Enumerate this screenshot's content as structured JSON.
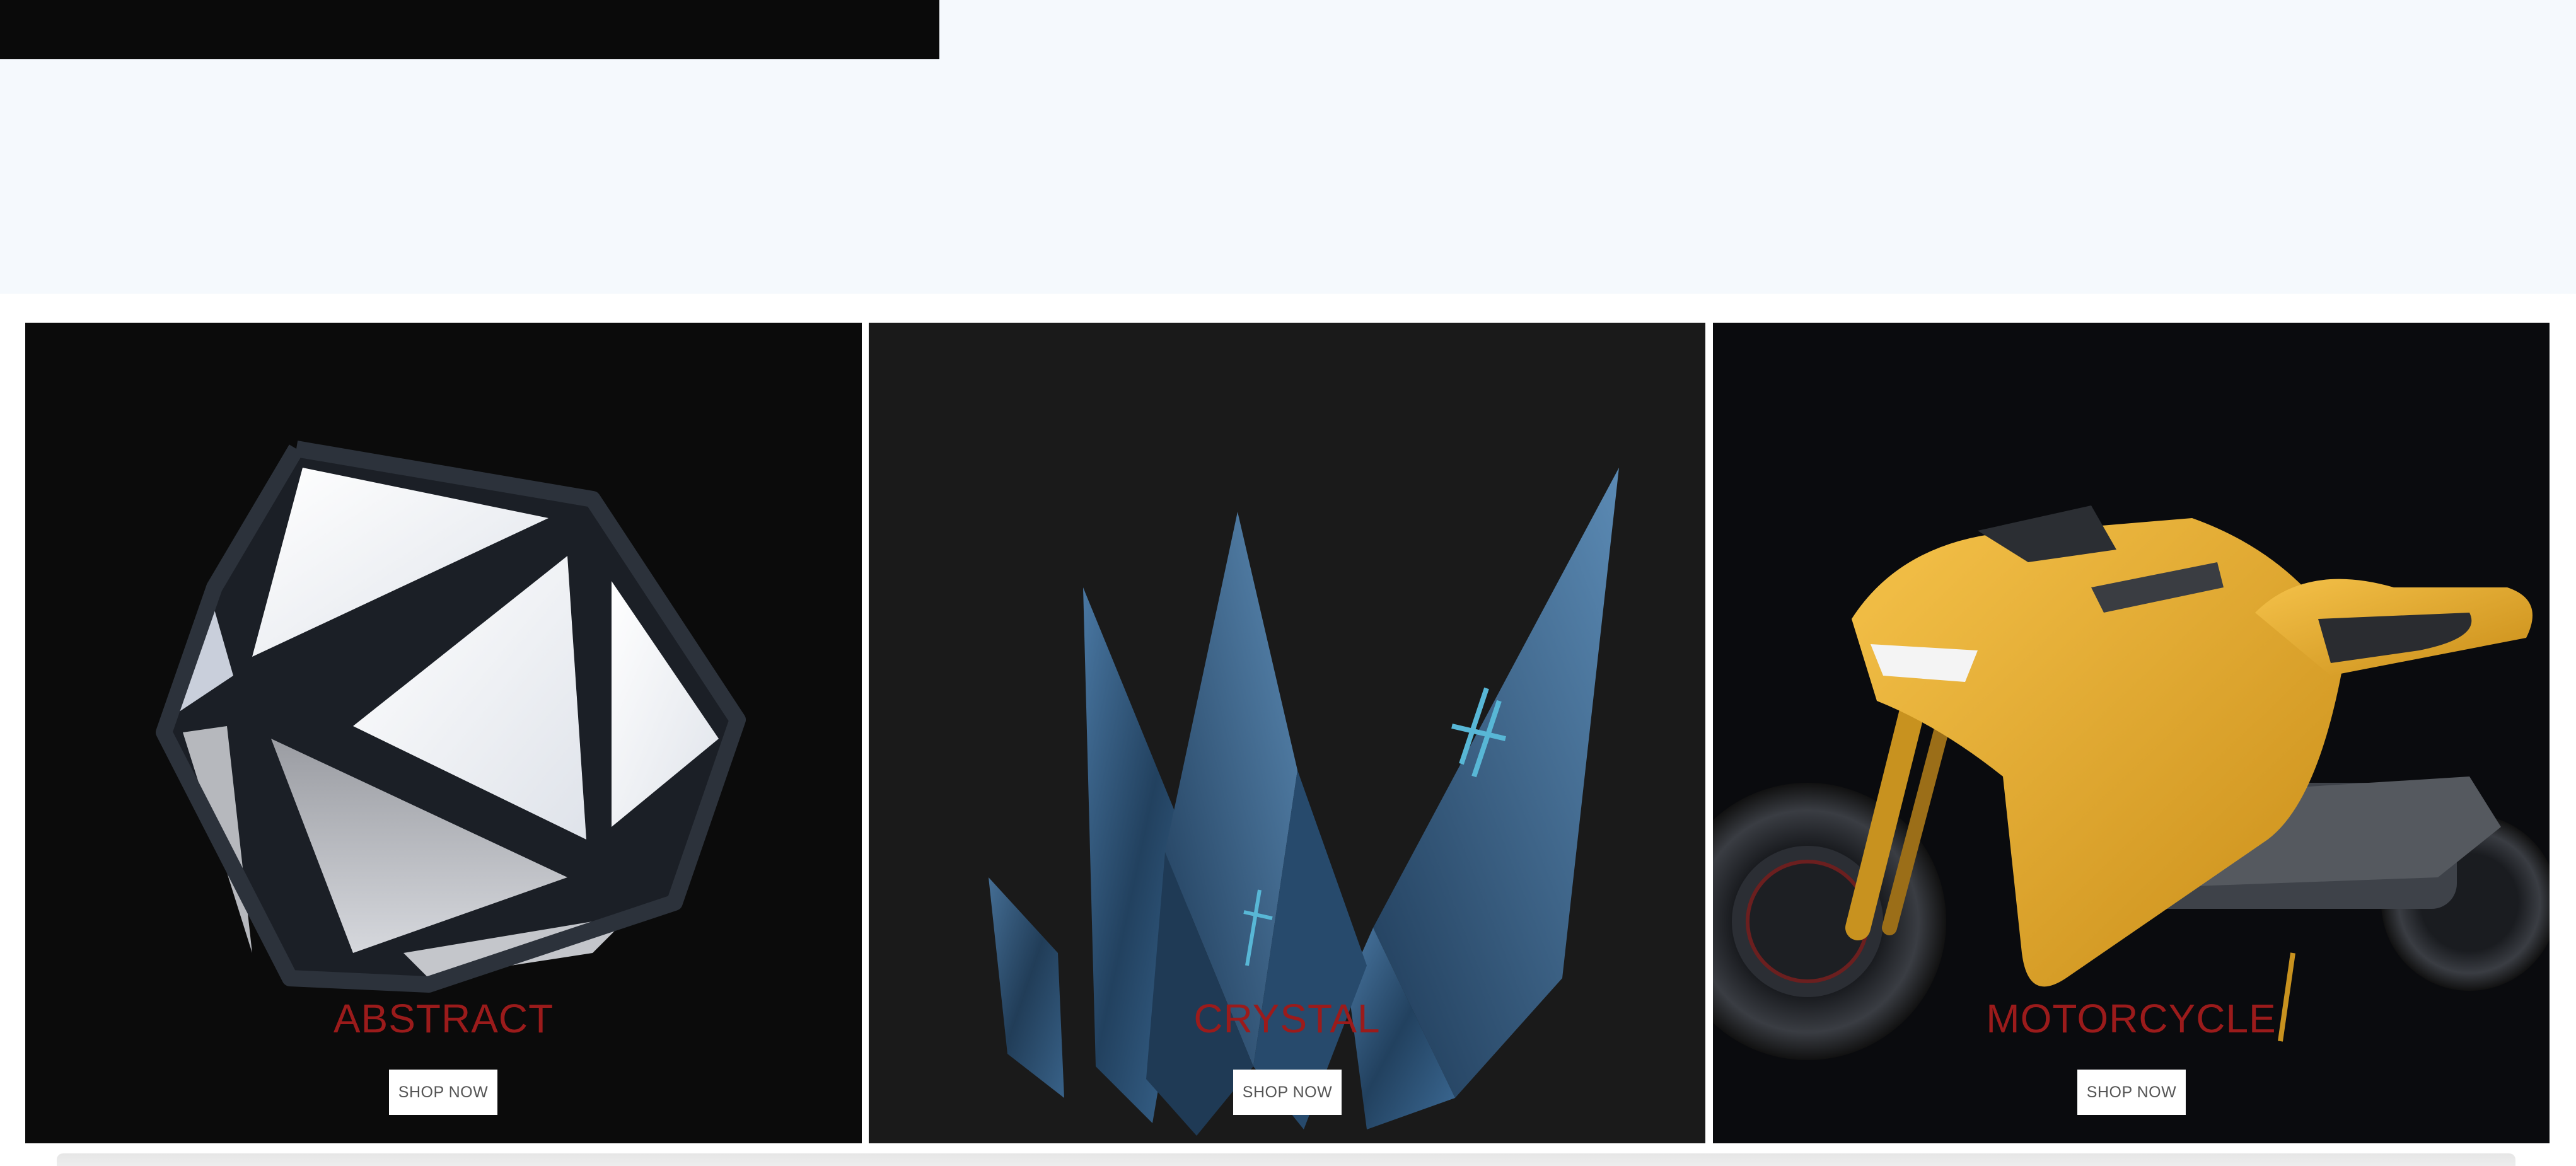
{
  "categories": [
    {
      "title": "ABSTRACT",
      "button_label": "SHOP NOW",
      "art": "icosahedron-icon",
      "background": "#0b0b0b"
    },
    {
      "title": "CRYSTAL",
      "button_label": "SHOP NOW",
      "art": "crystal-icon",
      "background": "#1a1a1a"
    },
    {
      "title": "MOTORCYCLE",
      "button_label": "SHOP NOW",
      "art": "motorcycle-icon",
      "background": "#0a0b0e"
    }
  ],
  "colors": {
    "title_accent": "#9b1b1b",
    "top_bar": "#0a0a0a",
    "page_background": "#f5f9fd",
    "motorcycle_body": "#e8aa2a",
    "crystal_body": "#2d5b86"
  }
}
